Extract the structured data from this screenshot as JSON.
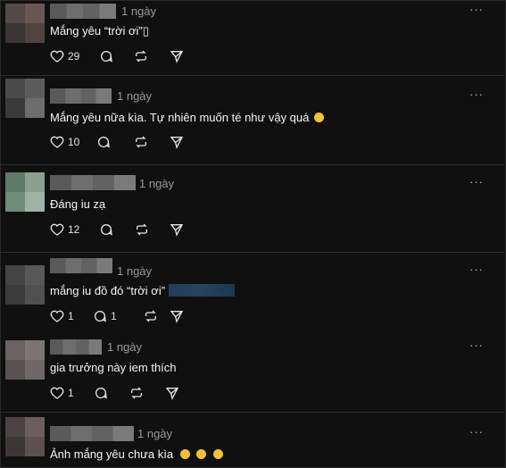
{
  "posts": [
    {
      "time": "1 ngày",
      "text": "Mắng yêu “trời ơi”",
      "trailing_glyph": "▯",
      "likes": "29",
      "avatar_colors": [
        "#564848",
        "#6b5656",
        "#3c3434",
        "#524343"
      ]
    },
    {
      "time": "1 ngày",
      "text": "Mắng yêu nữa kìa. Tự nhiên muốn té như vậy quá",
      "emoji": "laughing-rolling-emoji",
      "likes": "10",
      "avatar_colors": [
        "#4a4a4a",
        "#5c5c5c",
        "#3a3a3a",
        "#6d6d6d"
      ]
    },
    {
      "time": "1 ngày",
      "text": "Đáng iu zạ",
      "likes": "12",
      "avatar_colors": [
        "#5f7a6a",
        "#8aa192",
        "#6f8b7a",
        "#9cb3a5"
      ]
    },
    {
      "time": "1 ngày",
      "text": "mắng iu đồ đó “trời ơi”",
      "has_blurred_mention": true,
      "likes": "1",
      "replies": "1",
      "avatar_colors": [
        "#444444",
        "#585858",
        "#3b3b3b",
        "#505050"
      ]
    },
    {
      "time": "1 ngày",
      "text": "gia trưởng này iem thích",
      "likes": "1",
      "avatar_colors": [
        "#6a6262",
        "#7d7474",
        "#585252",
        "#6f6868"
      ]
    },
    {
      "time": "1 ngày",
      "text": "Ảnh mắng yêu chưa kìa",
      "emojis": [
        "smiling-emoji",
        "smiling-emoji",
        "smiling-emoji"
      ],
      "avatar_colors": [
        "#4c4444",
        "#6a5e5e",
        "#3d3636",
        "#5b5151"
      ]
    }
  ],
  "more_label": "···",
  "colors": {
    "background": "#101010",
    "text": "#f3f5f7",
    "muted": "#9a9a9a",
    "divider": "#2d2d2d"
  }
}
